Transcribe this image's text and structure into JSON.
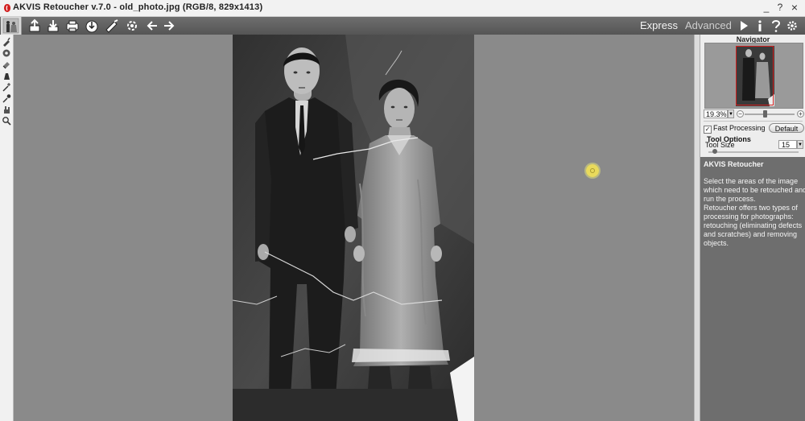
{
  "window": {
    "title": "AKVIS Retoucher v.7.0 - old_photo.jpg (RGB/8, 829x1413)",
    "controls": [
      "_",
      "?",
      "×"
    ]
  },
  "toolbar": {
    "icons": [
      "photo-thumbnail-icon",
      "open-file-icon",
      "save-icon",
      "print-icon",
      "share-icon",
      "settings-brush-icon",
      "run-process-icon",
      "undo-arrow-icon",
      "redo-arrow-icon"
    ],
    "modes": {
      "express": "Express",
      "advanced": "Advanced"
    },
    "right_icons": [
      "play-icon",
      "info-icon",
      "help-icon",
      "gear-icon"
    ]
  },
  "tools": [
    "retouch-brush-icon",
    "clone-stamp-icon",
    "eraser-icon",
    "chameleon-brush-icon",
    "magic-wand-icon",
    "eyedropper-icon",
    "hand-icon",
    "zoom-icon"
  ],
  "panel": {
    "navigator": {
      "title": "Navigator",
      "zoom_value": "19.3%",
      "zoom_level": 0.4
    },
    "fast_processing": {
      "label": "Fast Processing",
      "checked": true
    },
    "default_button": "Default",
    "tool_options": {
      "title": "Tool Options",
      "tool_size_label": "Tool Size",
      "tool_size_value": "15"
    },
    "help": {
      "title": "AKVIS Retoucher",
      "lines": [
        "Select the areas of the image",
        "which need to be retouched and",
        "run the process.",
        "Retoucher offers two types of",
        "processing for photographs:",
        "retouching (eliminating defects",
        "and scratches) and removing",
        "objects."
      ]
    }
  },
  "colors": {
    "toolbar": "#5f5f5f",
    "workspace": "#8a8a8a",
    "panel": "#ededed",
    "help_bg": "#6e6e6e",
    "cursor": "#eedd5a"
  }
}
